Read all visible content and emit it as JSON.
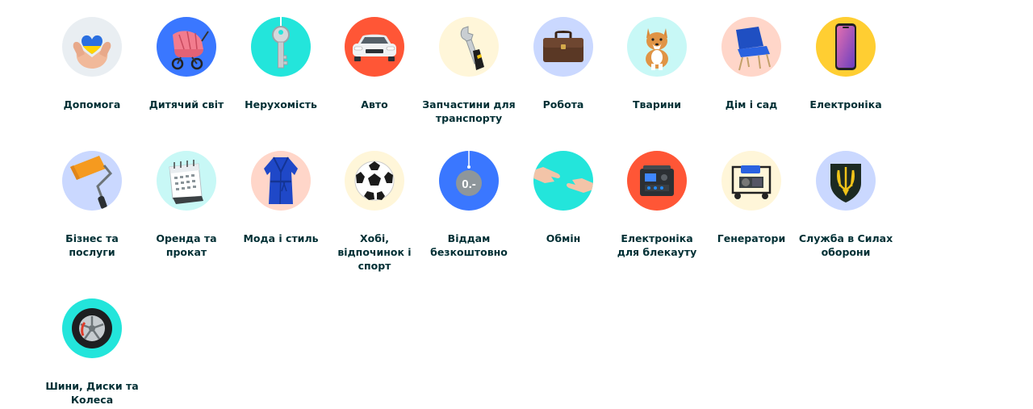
{
  "categories": [
    {
      "label": "Допомога",
      "icon": "hands-heart-icon",
      "bg": "#e9eef2"
    },
    {
      "label": "Дитячий світ",
      "icon": "stroller-icon",
      "bg": "#3a77ff"
    },
    {
      "label": "Нерухомість",
      "icon": "key-icon",
      "bg": "#23e5db"
    },
    {
      "label": "Авто",
      "icon": "car-icon",
      "bg": "#ff5636"
    },
    {
      "label": "Запчастини для транспорту",
      "icon": "wrench-icon",
      "bg": "#fff6d9"
    },
    {
      "label": "Робота",
      "icon": "briefcase-icon",
      "bg": "#cad8ff"
    },
    {
      "label": "Тварини",
      "icon": "dog-icon",
      "bg": "#c8f8f6"
    },
    {
      "label": "Дім і сад",
      "icon": "armchair-icon",
      "bg": "#ffd6c9"
    },
    {
      "label": "Електроніка",
      "icon": "smartphone-icon",
      "bg": "#ffce32"
    },
    {
      "label": "Бізнес та послуги",
      "icon": "paint-roller-icon",
      "bg": "#cad8ff"
    },
    {
      "label": "Оренда та прокат",
      "icon": "calendar-icon",
      "bg": "#c8f8f6"
    },
    {
      "label": "Мода і стиль",
      "icon": "bathrobe-icon",
      "bg": "#ffd6c9"
    },
    {
      "label": "Хобі, відпочинок і спорт",
      "icon": "soccer-ball-icon",
      "bg": "#fff6d9"
    },
    {
      "label": "Віддам безкоштовно",
      "icon": "price-tag-icon",
      "bg": "#3a77ff",
      "tag_text": "0.-"
    },
    {
      "label": "Обмін",
      "icon": "handshake-icon",
      "bg": "#23e5db"
    },
    {
      "label": "Електроніка для блекауту",
      "icon": "power-station-icon",
      "bg": "#ff5636"
    },
    {
      "label": "Генератори",
      "icon": "generator-icon",
      "bg": "#fff6d9"
    },
    {
      "label": "Служба в Силах оборони",
      "icon": "trident-shield-icon",
      "bg": "#cad8ff"
    },
    {
      "label": "Шини, Диски та Колеса",
      "icon": "wheel-icon",
      "bg": "#23e5db"
    }
  ]
}
